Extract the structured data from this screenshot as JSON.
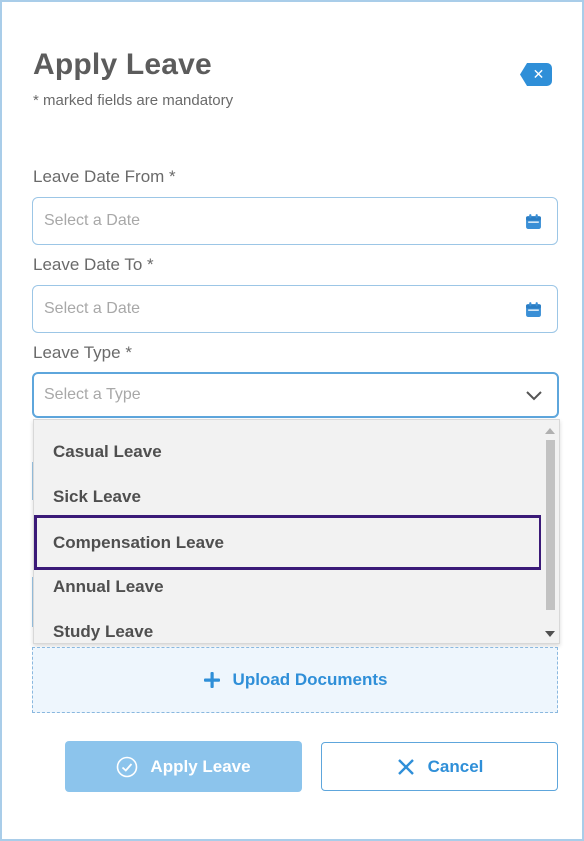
{
  "header": {
    "title": "Apply Leave",
    "subtitle": "* marked fields are mandatory",
    "close_icon": "backspace-x-icon"
  },
  "form": {
    "date_from": {
      "label": "Leave Date From *",
      "placeholder": "Select a Date",
      "icon": "calendar-icon"
    },
    "date_to": {
      "label": "Leave Date To *",
      "placeholder": "Select a Date",
      "icon": "calendar-icon"
    },
    "leave_type": {
      "label": "Leave Type *",
      "placeholder": "Select a Type",
      "icon": "chevron-down-icon",
      "options": [
        "Casual Leave",
        "Sick Leave",
        "Compensation Leave",
        "Annual Leave",
        "Study Leave"
      ],
      "highlighted": "Compensation Leave"
    }
  },
  "upload": {
    "label": "Upload Documents",
    "icon": "plus-icon"
  },
  "actions": {
    "apply_label": "Apply Leave",
    "apply_icon": "check-circle-icon",
    "cancel_label": "Cancel",
    "cancel_icon": "x-icon"
  },
  "colors": {
    "accent": "#2f8fd8",
    "border": "#9cc6e6",
    "apply_button": "#8cc4ec",
    "highlight_border": "#3b1a78",
    "dropdown_bg": "#f2f2f2"
  }
}
